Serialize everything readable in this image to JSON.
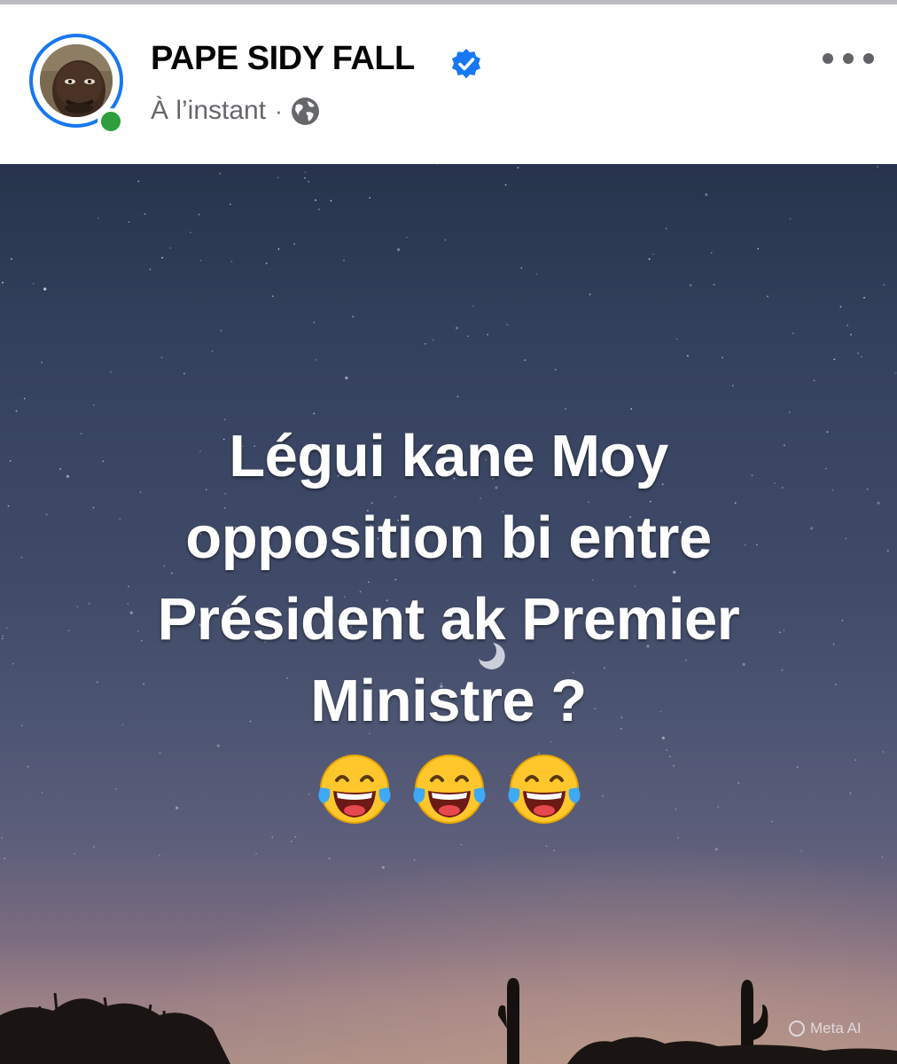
{
  "post": {
    "author": "PAPE SIDY FALL",
    "verified": true,
    "timestamp": "À l’instant",
    "separator": "·",
    "audience_icon": "globe-icon",
    "menu_icon": "more-options-icon",
    "online_status": "online",
    "text_lines": [
      "Légui kane Moy",
      "opposition bi entre",
      "Président ak Premier",
      "Ministre ?"
    ],
    "emojis": [
      "face-with-tears-of-joy",
      "face-with-tears-of-joy",
      "face-with-tears-of-joy"
    ],
    "watermark": "Meta AI"
  },
  "colors": {
    "brand_blue": "#1877f2",
    "online_green": "#2e9e3f",
    "name_text": "#050505",
    "meta_text": "#65676b"
  }
}
